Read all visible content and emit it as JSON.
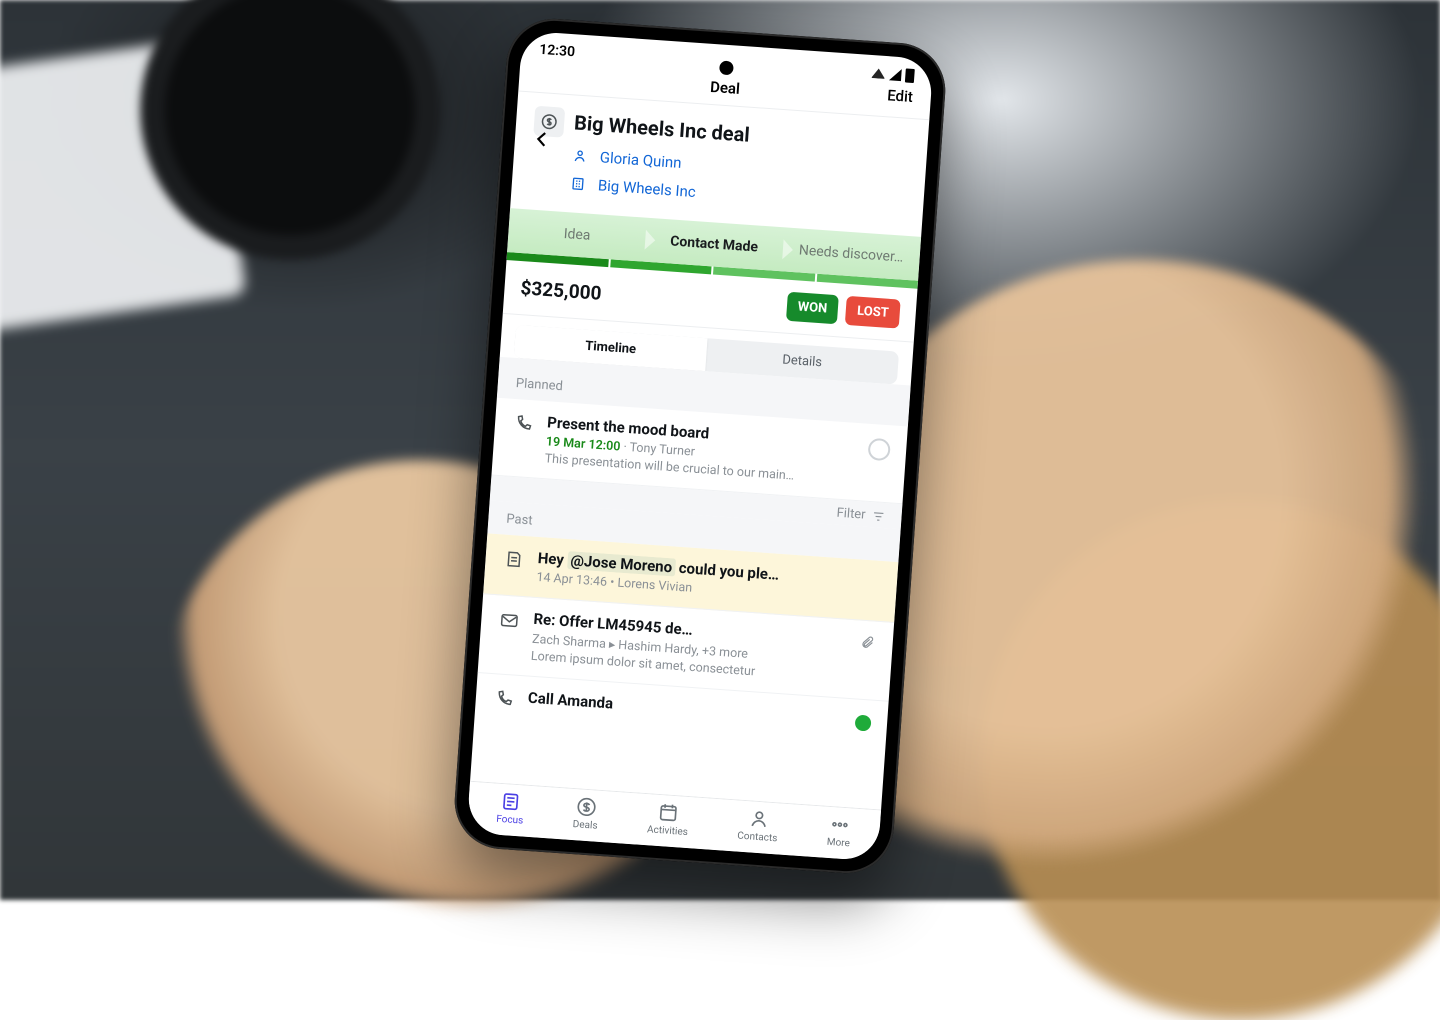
{
  "statusbar": {
    "time": "12:30"
  },
  "topbar": {
    "title": "Deal",
    "edit": "Edit"
  },
  "deal": {
    "title": "Big Wheels Inc deal",
    "contact": "Gloria Quinn",
    "org": "Big Wheels Inc",
    "amount": "$325,000"
  },
  "stages": {
    "s1": "Idea",
    "s2": "Contact Made",
    "s3": "Needs discover…"
  },
  "buttons": {
    "won": "WON",
    "lost": "LOST"
  },
  "tabs": {
    "timeline": "Timeline",
    "details": "Details"
  },
  "sections": {
    "planned": "Planned",
    "past": "Past",
    "filter": "Filter"
  },
  "planned_item": {
    "title": "Present the mood board",
    "when": "19 Mar 12:00",
    "sep": " · ",
    "who": "Tony Turner",
    "desc": "This presentation will be crucial to our main…"
  },
  "past_note": {
    "prefix": "Hey ",
    "mention": "@Jose Moreno",
    "suffix": " could you ple…",
    "meta": "14 Apr 13:46 • Lorens Vivian"
  },
  "past_email": {
    "title": "Re: Offer LM45945 de…",
    "from": "Zach Sharma",
    "arrow": " ▸ ",
    "to": "Hashim Hardy, +3 more",
    "desc": "Lorem ipsum dolor sit amet, consectetur"
  },
  "past_call": {
    "title": "Call Amanda"
  },
  "nav": {
    "focus": "Focus",
    "deals": "Deals",
    "activities": "Activities",
    "contacts": "Contacts",
    "more": "More"
  }
}
